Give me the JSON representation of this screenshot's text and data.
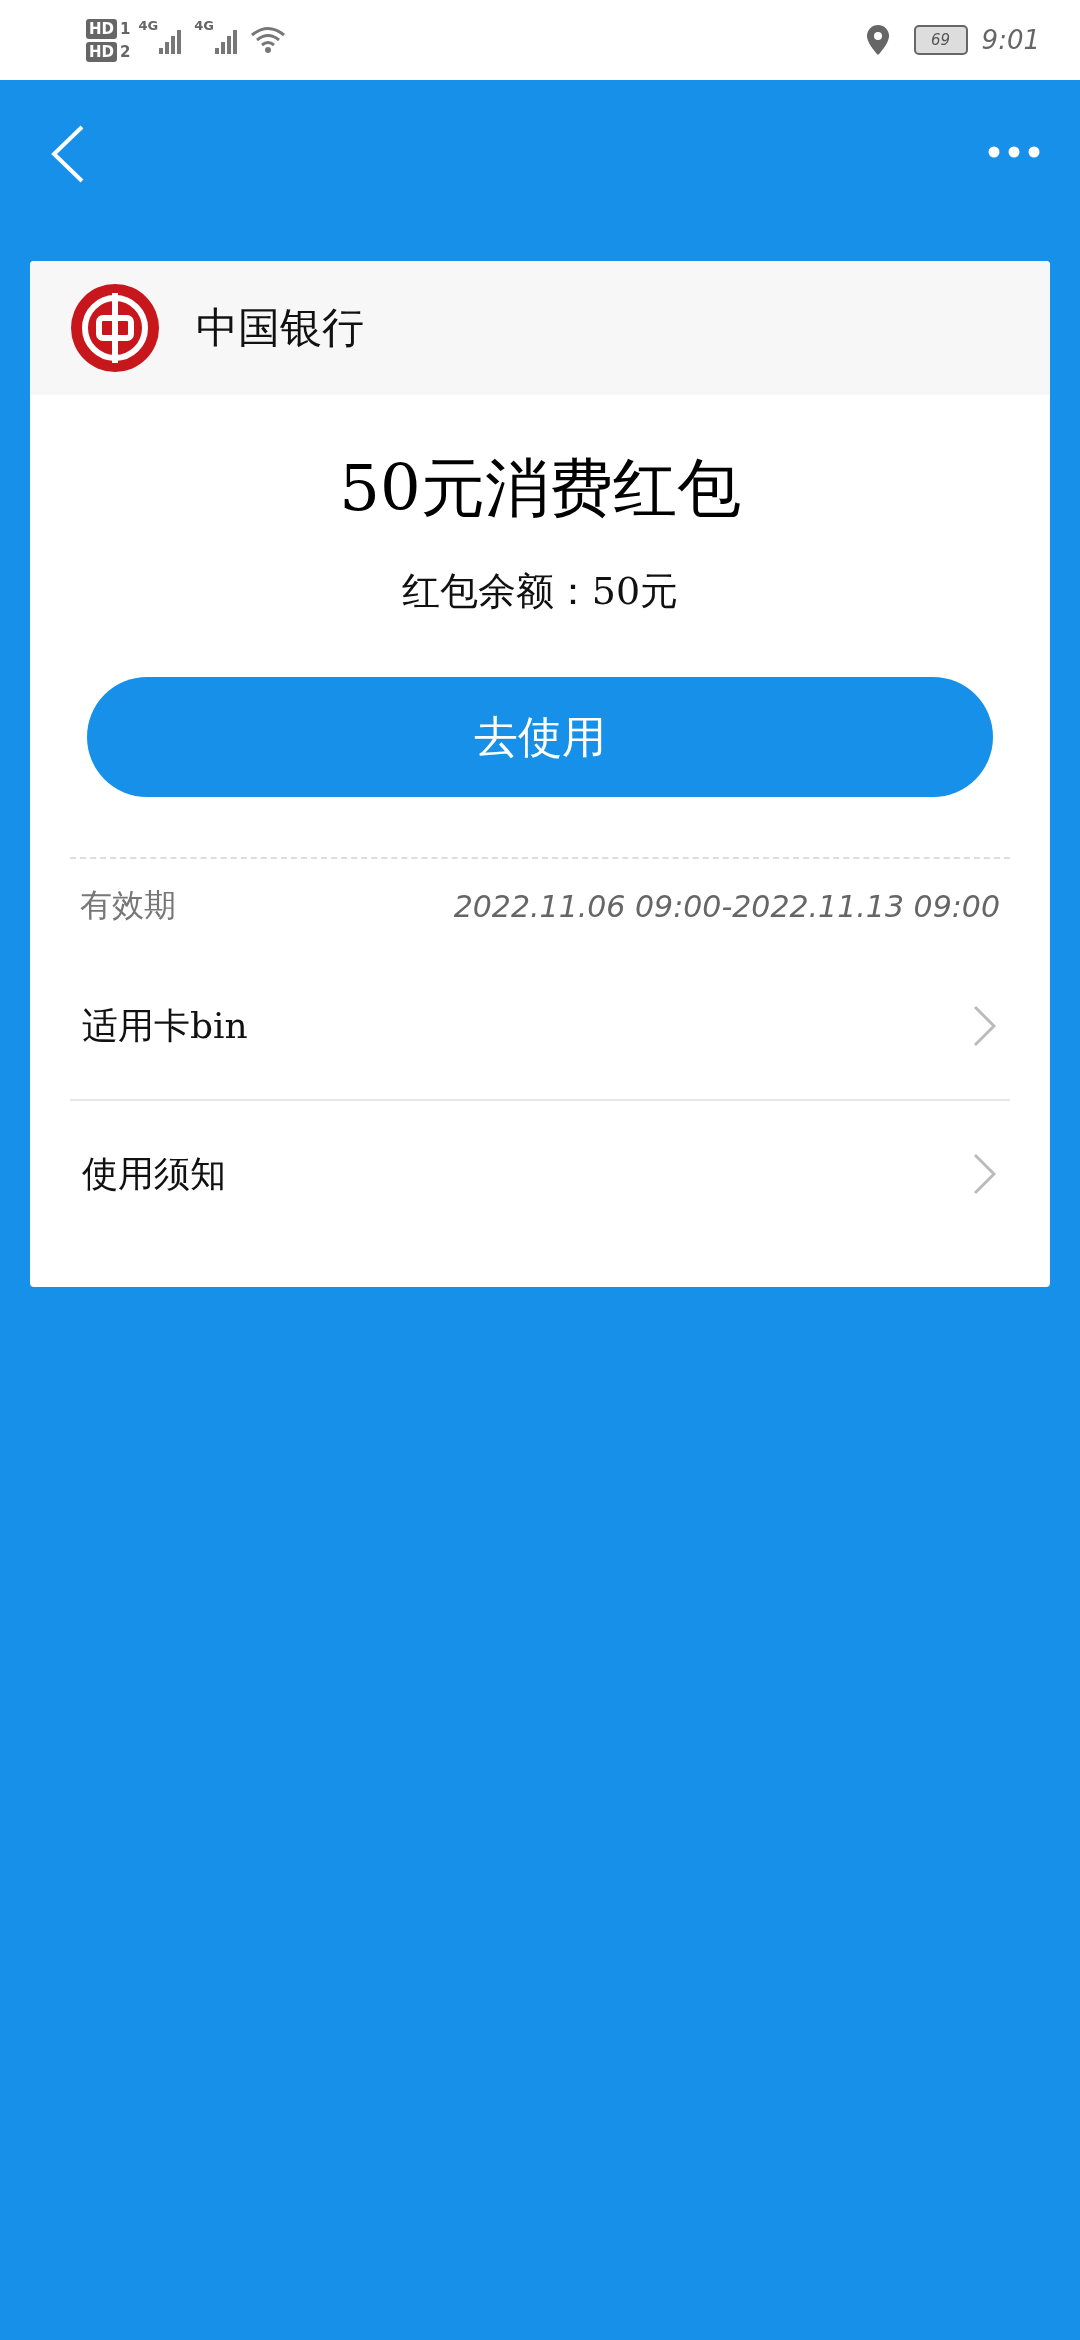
{
  "status_bar": {
    "sims": [
      {
        "badge": "HD",
        "slot": "1",
        "network": "4G"
      },
      {
        "badge": "HD",
        "slot": "2",
        "network": "4G"
      }
    ],
    "battery": "69",
    "time": "9:01"
  },
  "bank": {
    "name": "中国银行"
  },
  "coupon": {
    "title": "50元消费红包",
    "balance": "红包余额：50元",
    "button": "去使用"
  },
  "validity": {
    "label": "有效期",
    "value": "2022.11.06 09:00-2022.11.13 09:00"
  },
  "links": [
    {
      "label": "适用卡bin"
    },
    {
      "label": "使用须知"
    }
  ]
}
